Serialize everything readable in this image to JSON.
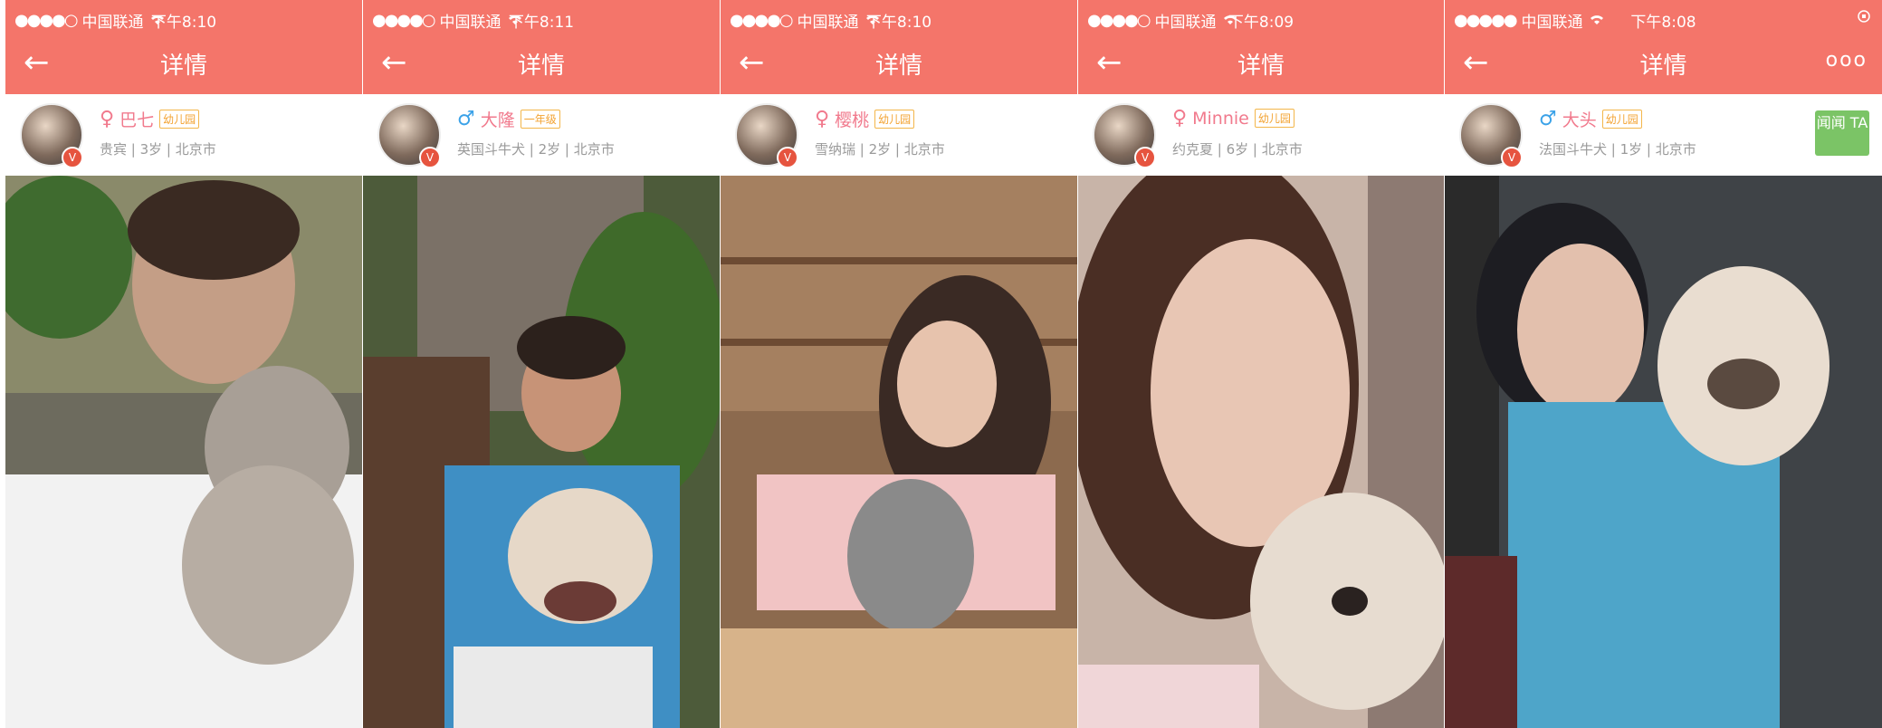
{
  "common": {
    "nav_title": "详情",
    "back_glyph": "←"
  },
  "phones": [
    {
      "carrier": "中国联通",
      "time": "下午8:10",
      "gender_symbol": "♀",
      "name": "巴七",
      "tag": "幼儿园",
      "subline": "贵宾 | 3岁 | 北京市",
      "v_badge": "V"
    },
    {
      "carrier": "中国联通",
      "time": "下午8:11",
      "gender_symbol": "♂",
      "name": "大隆",
      "tag": "一年级",
      "subline": "英国斗牛犬 | 2岁 | 北京市",
      "v_badge": "V"
    },
    {
      "carrier": "中国联通",
      "time": "下午8:10",
      "gender_symbol": "♀",
      "name": "樱桃",
      "tag": "幼儿园",
      "subline": "雪纳瑞 | 2岁 | 北京市",
      "v_badge": "V"
    },
    {
      "carrier": "中国联通",
      "time": "下午8:09",
      "gender_symbol": "♀",
      "name": "Minnie",
      "tag": "幼儿园",
      "subline": "约克夏 | 6岁 | 北京市",
      "v_badge": "V"
    },
    {
      "carrier": "中国联通",
      "time": "下午8:08",
      "gender_symbol": "♂",
      "name": "大头",
      "tag": "幼儿园",
      "subline": "法国斗牛犬 | 1岁 | 北京市",
      "v_badge": "V",
      "more_glyph": "ooo",
      "follow_label": "闻闻 TA"
    }
  ],
  "colors": {
    "nav_bg": "#f4756a",
    "female": "#f17a8d",
    "male": "#3ba2e8",
    "tag": "#f3a332",
    "follow": "#7bc466"
  }
}
